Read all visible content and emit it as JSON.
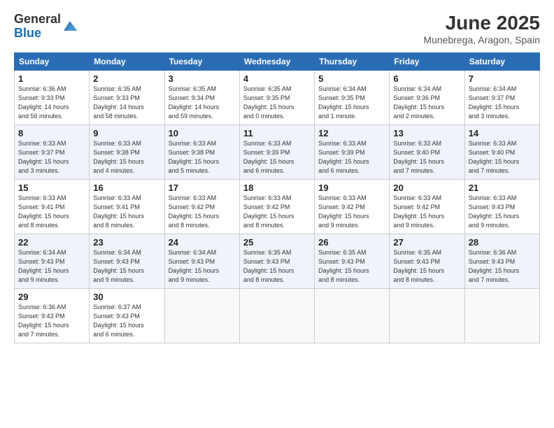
{
  "logo": {
    "general": "General",
    "blue": "Blue"
  },
  "title": "June 2025",
  "subtitle": "Munebrega, Aragon, Spain",
  "days_of_week": [
    "Sunday",
    "Monday",
    "Tuesday",
    "Wednesday",
    "Thursday",
    "Friday",
    "Saturday"
  ],
  "weeks": [
    [
      {
        "day": "1",
        "lines": [
          "Sunrise: 6:36 AM",
          "Sunset: 9:33 PM",
          "Daylight: 14 hours",
          "and 56 minutes."
        ]
      },
      {
        "day": "2",
        "lines": [
          "Sunrise: 6:35 AM",
          "Sunset: 9:33 PM",
          "Daylight: 14 hours",
          "and 58 minutes."
        ]
      },
      {
        "day": "3",
        "lines": [
          "Sunrise: 6:35 AM",
          "Sunset: 9:34 PM",
          "Daylight: 14 hours",
          "and 59 minutes."
        ]
      },
      {
        "day": "4",
        "lines": [
          "Sunrise: 6:35 AM",
          "Sunset: 9:35 PM",
          "Daylight: 15 hours",
          "and 0 minutes."
        ]
      },
      {
        "day": "5",
        "lines": [
          "Sunrise: 6:34 AM",
          "Sunset: 9:35 PM",
          "Daylight: 15 hours",
          "and 1 minute."
        ]
      },
      {
        "day": "6",
        "lines": [
          "Sunrise: 6:34 AM",
          "Sunset: 9:36 PM",
          "Daylight: 15 hours",
          "and 2 minutes."
        ]
      },
      {
        "day": "7",
        "lines": [
          "Sunrise: 6:34 AM",
          "Sunset: 9:37 PM",
          "Daylight: 15 hours",
          "and 3 minutes."
        ]
      }
    ],
    [
      {
        "day": "8",
        "lines": [
          "Sunrise: 6:33 AM",
          "Sunset: 9:37 PM",
          "Daylight: 15 hours",
          "and 3 minutes."
        ]
      },
      {
        "day": "9",
        "lines": [
          "Sunrise: 6:33 AM",
          "Sunset: 9:38 PM",
          "Daylight: 15 hours",
          "and 4 minutes."
        ]
      },
      {
        "day": "10",
        "lines": [
          "Sunrise: 6:33 AM",
          "Sunset: 9:38 PM",
          "Daylight: 15 hours",
          "and 5 minutes."
        ]
      },
      {
        "day": "11",
        "lines": [
          "Sunrise: 6:33 AM",
          "Sunset: 9:39 PM",
          "Daylight: 15 hours",
          "and 6 minutes."
        ]
      },
      {
        "day": "12",
        "lines": [
          "Sunrise: 6:33 AM",
          "Sunset: 9:39 PM",
          "Daylight: 15 hours",
          "and 6 minutes."
        ]
      },
      {
        "day": "13",
        "lines": [
          "Sunrise: 6:33 AM",
          "Sunset: 9:40 PM",
          "Daylight: 15 hours",
          "and 7 minutes."
        ]
      },
      {
        "day": "14",
        "lines": [
          "Sunrise: 6:33 AM",
          "Sunset: 9:40 PM",
          "Daylight: 15 hours",
          "and 7 minutes."
        ]
      }
    ],
    [
      {
        "day": "15",
        "lines": [
          "Sunrise: 6:33 AM",
          "Sunset: 9:41 PM",
          "Daylight: 15 hours",
          "and 8 minutes."
        ]
      },
      {
        "day": "16",
        "lines": [
          "Sunrise: 6:33 AM",
          "Sunset: 9:41 PM",
          "Daylight: 15 hours",
          "and 8 minutes."
        ]
      },
      {
        "day": "17",
        "lines": [
          "Sunrise: 6:33 AM",
          "Sunset: 9:42 PM",
          "Daylight: 15 hours",
          "and 8 minutes."
        ]
      },
      {
        "day": "18",
        "lines": [
          "Sunrise: 6:33 AM",
          "Sunset: 9:42 PM",
          "Daylight: 15 hours",
          "and 8 minutes."
        ]
      },
      {
        "day": "19",
        "lines": [
          "Sunrise: 6:33 AM",
          "Sunset: 9:42 PM",
          "Daylight: 15 hours",
          "and 9 minutes."
        ]
      },
      {
        "day": "20",
        "lines": [
          "Sunrise: 6:33 AM",
          "Sunset: 9:42 PM",
          "Daylight: 15 hours",
          "and 9 minutes."
        ]
      },
      {
        "day": "21",
        "lines": [
          "Sunrise: 6:33 AM",
          "Sunset: 9:43 PM",
          "Daylight: 15 hours",
          "and 9 minutes."
        ]
      }
    ],
    [
      {
        "day": "22",
        "lines": [
          "Sunrise: 6:34 AM",
          "Sunset: 9:43 PM",
          "Daylight: 15 hours",
          "and 9 minutes."
        ]
      },
      {
        "day": "23",
        "lines": [
          "Sunrise: 6:34 AM",
          "Sunset: 9:43 PM",
          "Daylight: 15 hours",
          "and 9 minutes."
        ]
      },
      {
        "day": "24",
        "lines": [
          "Sunrise: 6:34 AM",
          "Sunset: 9:43 PM",
          "Daylight: 15 hours",
          "and 9 minutes."
        ]
      },
      {
        "day": "25",
        "lines": [
          "Sunrise: 6:35 AM",
          "Sunset: 9:43 PM",
          "Daylight: 15 hours",
          "and 8 minutes."
        ]
      },
      {
        "day": "26",
        "lines": [
          "Sunrise: 6:35 AM",
          "Sunset: 9:43 PM",
          "Daylight: 15 hours",
          "and 8 minutes."
        ]
      },
      {
        "day": "27",
        "lines": [
          "Sunrise: 6:35 AM",
          "Sunset: 9:43 PM",
          "Daylight: 15 hours",
          "and 8 minutes."
        ]
      },
      {
        "day": "28",
        "lines": [
          "Sunrise: 6:36 AM",
          "Sunset: 9:43 PM",
          "Daylight: 15 hours",
          "and 7 minutes."
        ]
      }
    ],
    [
      {
        "day": "29",
        "lines": [
          "Sunrise: 6:36 AM",
          "Sunset: 9:43 PM",
          "Daylight: 15 hours",
          "and 7 minutes."
        ]
      },
      {
        "day": "30",
        "lines": [
          "Sunrise: 6:37 AM",
          "Sunset: 9:43 PM",
          "Daylight: 15 hours",
          "and 6 minutes."
        ]
      },
      null,
      null,
      null,
      null,
      null
    ]
  ],
  "colors": {
    "header_bg": "#2a6db5",
    "alt_row": "#f0f4fa"
  }
}
